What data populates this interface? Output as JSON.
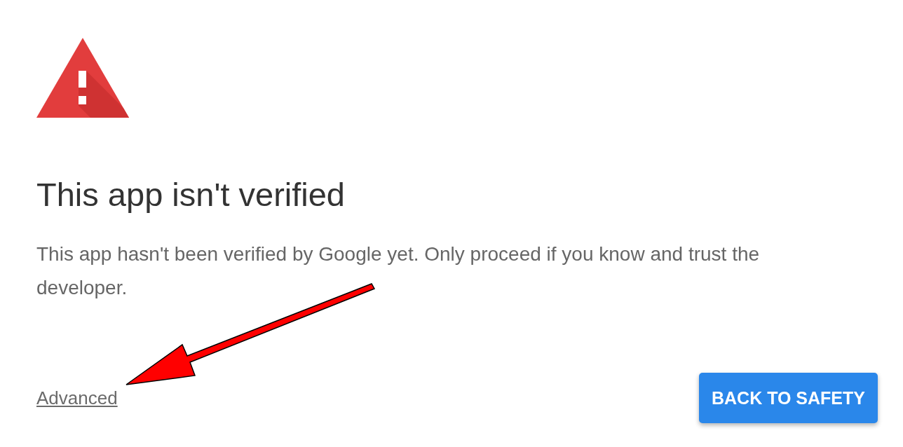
{
  "alert": {
    "title": "This app isn't verified",
    "message": "This app hasn't been verified by Google yet. Only proceed if you know and trust the developer."
  },
  "actions": {
    "advanced_link": "Advanced",
    "primary_button": "BACK TO SAFETY"
  }
}
